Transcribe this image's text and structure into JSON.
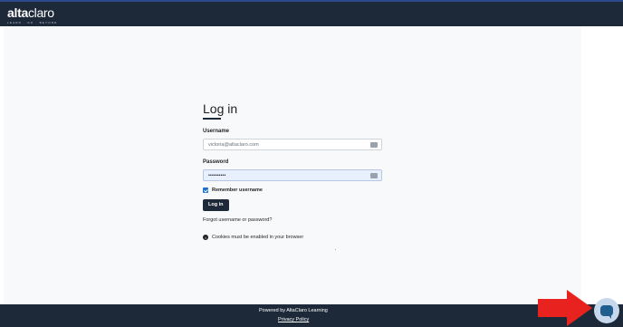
{
  "header": {
    "logo_bold": "alta",
    "logo_light": "claro",
    "logo_tagline": "LEARN · GO · BEYOND"
  },
  "login": {
    "title": "Log in",
    "username_label": "Username",
    "username_value": "victoria@altaclaro.com",
    "password_label": "Password",
    "password_value": "••••••••••",
    "remember_label": "Remember username",
    "remember_checked": true,
    "login_button": "Log in",
    "forgot_link": "Forgot username or password?",
    "cookies_notice": "Cookies must be enabled in your browser"
  },
  "footer": {
    "powered_by": "Powered by AltaClaro Learning",
    "privacy_link": "Privacy Policy"
  },
  "colors": {
    "header_bg": "#1d2838",
    "page_bg": "#f8f9fa",
    "button_bg": "#1d2838",
    "arrow": "#e8231f",
    "chat_bg": "#c7d8ec",
    "chat_icon": "#1f5f8f"
  },
  "icons": {
    "info": "info-icon",
    "chat": "chat-icon",
    "arrow": "arrow-right-icon",
    "key": "key-icon"
  }
}
